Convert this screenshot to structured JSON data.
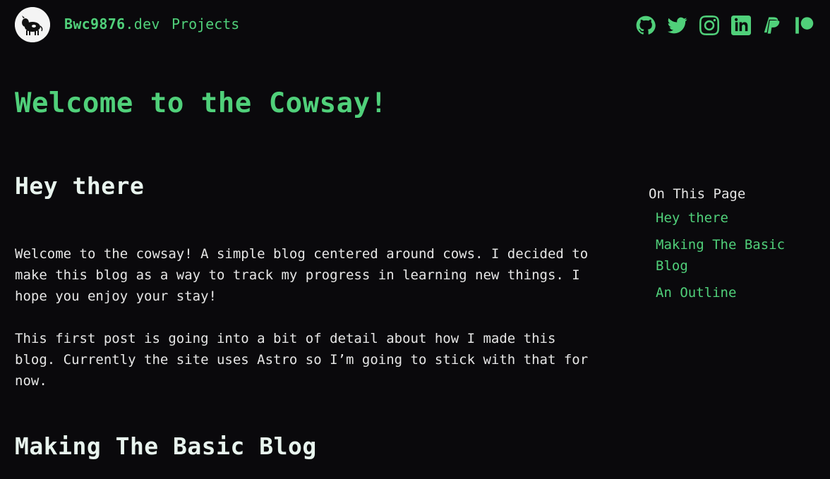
{
  "header": {
    "brand_bold": "Bwc9876",
    "brand_suffix": ".dev",
    "nav_projects": "Projects",
    "socials": [
      "github-icon",
      "twitter-icon",
      "instagram-icon",
      "linkedin-icon",
      "paypal-icon",
      "patreon-icon"
    ]
  },
  "page": {
    "title": "Welcome to the Cowsay!"
  },
  "content": {
    "h_hey": "Hey there",
    "p1": "Welcome to the cowsay! A simple blog centered around cows. I decided to make this blog as a way to track my progress in learning new things. I hope you enjoy your stay!",
    "p2": "This first post is going into a bit of detail about how I made this blog. Currently the site uses Astro so I’m going to stick with that for now.",
    "h_making": "Making The Basic Blog"
  },
  "toc": {
    "title": "On This Page",
    "items": [
      {
        "label": "Hey there"
      },
      {
        "label": "Making The Basic Blog"
      },
      {
        "label": "An Outline"
      }
    ]
  },
  "colors": {
    "background": "#0a090c",
    "accent": "#50d07a",
    "text": "#e6e6e6"
  }
}
